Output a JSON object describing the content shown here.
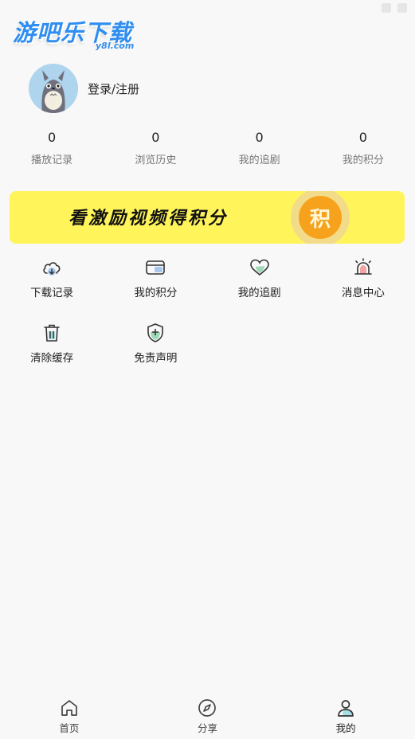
{
  "brand": {
    "name": "游吧乐下载",
    "domain": "y8l.com",
    "color": "#2f8ef0"
  },
  "profile": {
    "login_label": "登录/注册",
    "avatar_icon": "totoro-avatar"
  },
  "stats": [
    {
      "value": "0",
      "label": "播放记录"
    },
    {
      "value": "0",
      "label": "浏览历史"
    },
    {
      "value": "0",
      "label": "我的追剧"
    },
    {
      "value": "0",
      "label": "我的积分"
    }
  ],
  "banner": {
    "text": "看激励视频得积分",
    "coin_label": "积",
    "background": "#fff45a",
    "coin_color": "#f6a21c"
  },
  "menu": [
    {
      "label": "下载记录",
      "icon": "cloud-download-icon"
    },
    {
      "label": "我的积分",
      "icon": "card-icon"
    },
    {
      "label": "我的追剧",
      "icon": "heart-icon"
    },
    {
      "label": "消息中心",
      "icon": "alarm-icon"
    },
    {
      "label": "清除缓存",
      "icon": "trash-icon"
    },
    {
      "label": "免责声明",
      "icon": "shield-icon"
    }
  ],
  "tabbar": [
    {
      "label": "首页",
      "icon": "home-icon"
    },
    {
      "label": "分享",
      "icon": "compass-icon"
    },
    {
      "label": "我的",
      "icon": "user-icon",
      "active": true
    }
  ]
}
